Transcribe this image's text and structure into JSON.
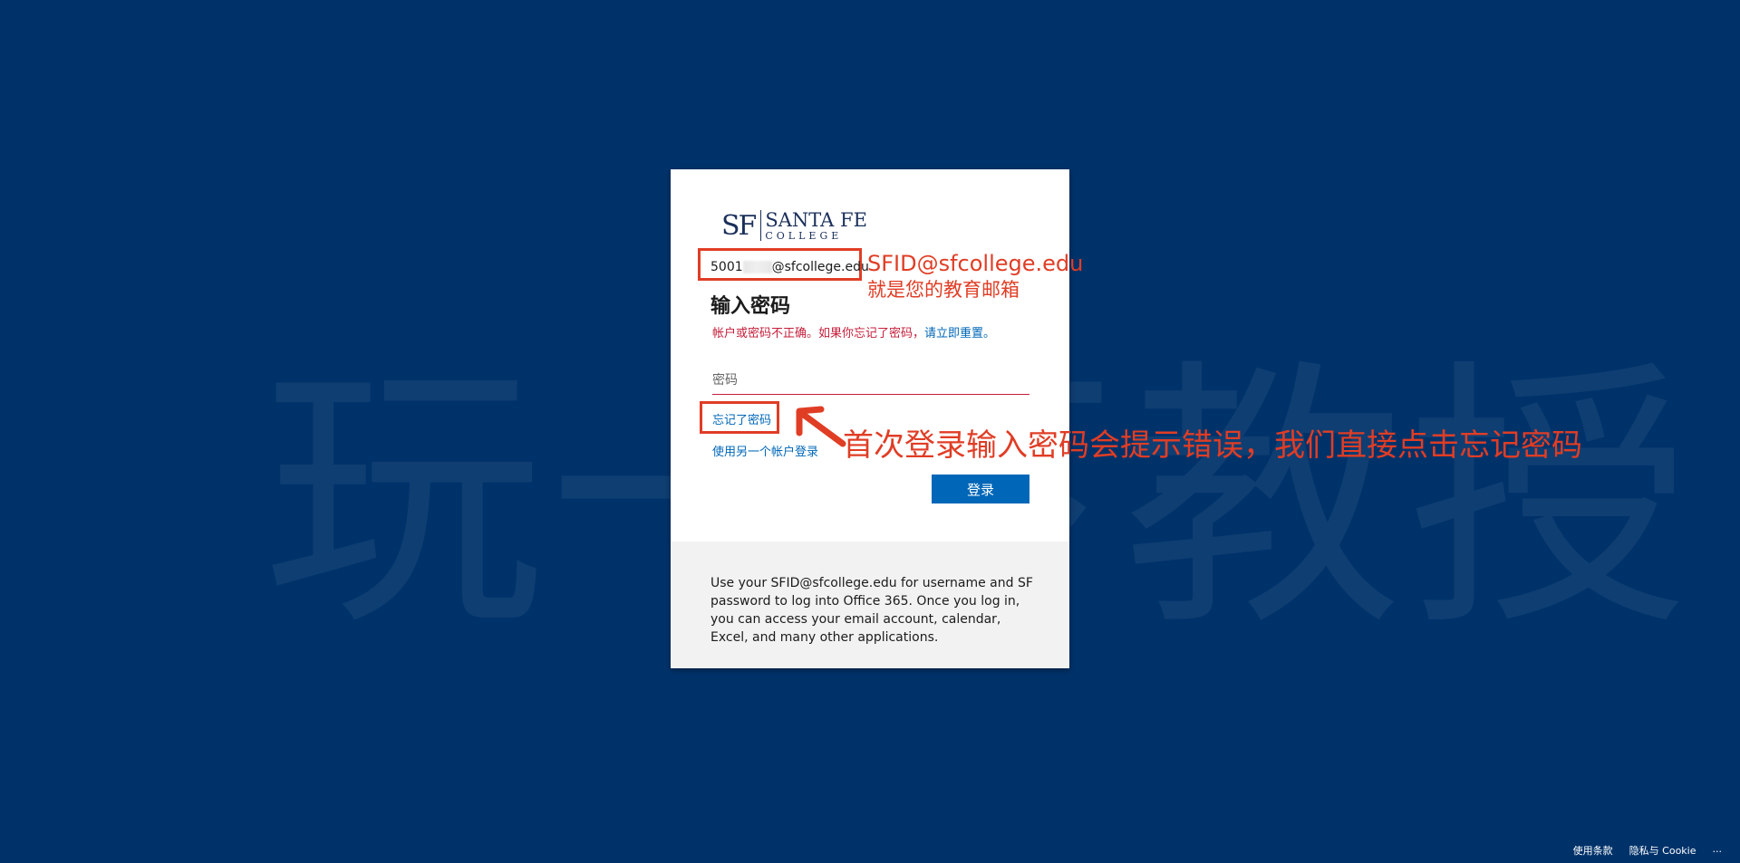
{
  "watermark": "玩一下教授",
  "logo": {
    "sf": "SF",
    "name": "SANTA FE",
    "sub": "COLLEGE"
  },
  "account": {
    "email_prefix": "5001",
    "email_suffix": "@sfcollege.edu"
  },
  "form": {
    "heading": "输入密码",
    "error_text": "帐户或密码不正确。如果你忘记了密码，",
    "error_link": "请立即重置。",
    "password_placeholder": "密码",
    "forgot_link": "忘记了密码",
    "other_account_link": "使用另一个帐户登录",
    "signin_button": "登录"
  },
  "footer": {
    "text": "Use your SFID@sfcollege.edu for username and SF password to log into Office 365. Once you log in, you can access your email account, calendar, Excel, and many other applications."
  },
  "annotations": {
    "email_note": "SFID@sfcollege.edu",
    "email_note_sub": "就是您的教育邮箱",
    "forgot_note": "首次登录输入密码会提示错误，我们直接点击忘记密码"
  },
  "bottom": {
    "terms": "使用条款",
    "privacy": "隐私与 Cookie",
    "more": "..."
  },
  "colors": {
    "background": "#00326a",
    "accent": "#0067b8",
    "error": "#c41e3a",
    "annotation": "#e03d25"
  }
}
